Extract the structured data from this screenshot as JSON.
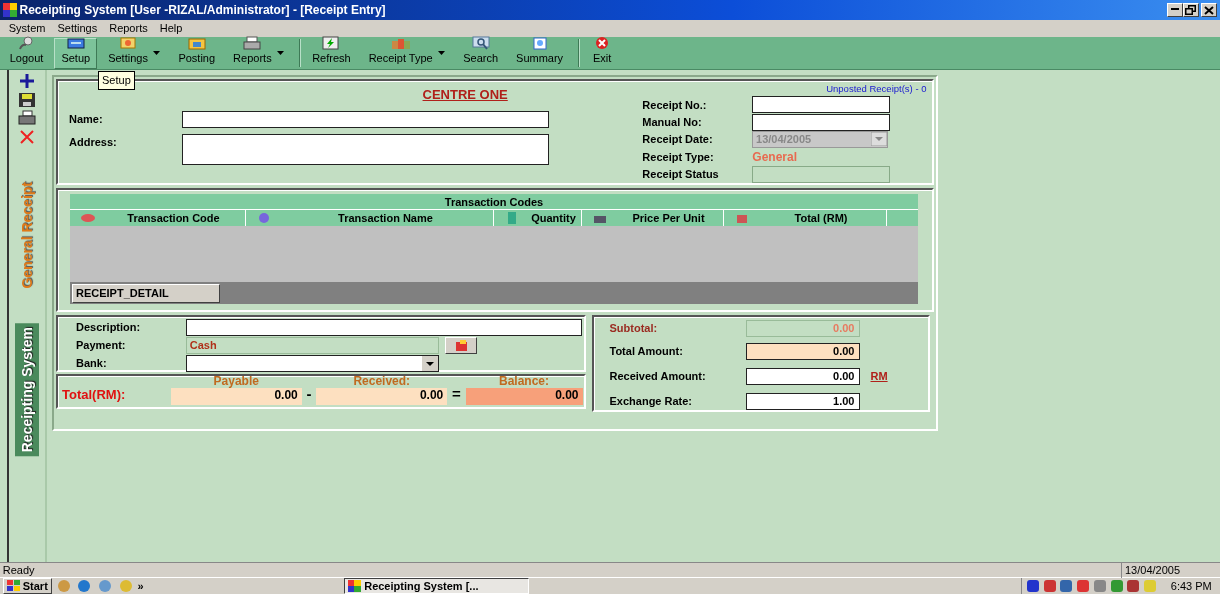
{
  "window": {
    "title": "Receipting System  [User -RIZAL/Administrator] - [Receipt Entry]"
  },
  "menu": [
    "System",
    "Settings",
    "Reports",
    "Help"
  ],
  "toolbar": [
    {
      "kind": "button",
      "label": "Logout",
      "dropdown": false,
      "selected": false
    },
    {
      "kind": "button",
      "label": "Setup",
      "dropdown": false,
      "selected": true
    },
    {
      "kind": "button",
      "label": "Settings",
      "dropdown": true,
      "selected": false
    },
    {
      "kind": "button",
      "label": "Posting",
      "dropdown": false,
      "selected": false
    },
    {
      "kind": "button",
      "label": "Reports",
      "dropdown": true,
      "selected": false
    },
    {
      "kind": "separator"
    },
    {
      "kind": "button",
      "label": "Refresh",
      "dropdown": false,
      "selected": false
    },
    {
      "kind": "button",
      "label": "Receipt Type",
      "dropdown": true,
      "selected": false
    },
    {
      "kind": "button",
      "label": "Search",
      "dropdown": false,
      "selected": false
    },
    {
      "kind": "button",
      "label": "Summary",
      "dropdown": false,
      "selected": false
    },
    {
      "kind": "separator"
    },
    {
      "kind": "button",
      "label": "Exit",
      "dropdown": false,
      "selected": false
    }
  ],
  "tooltip": "Setup",
  "side_tabs": [
    {
      "label": "General Receipt",
      "selected": true
    },
    {
      "label": "Receipting System",
      "selected": false
    }
  ],
  "header": {
    "centre": "CENTRE ONE",
    "unposted": "Unposted Receipt(s) - 0",
    "left_fields": [
      {
        "label": "Name:",
        "kind": "text"
      },
      {
        "label": "Address:",
        "kind": "textarea"
      }
    ],
    "right_fields": [
      {
        "label": "Receipt No.:",
        "kind": "text"
      },
      {
        "label": "Manual No:",
        "kind": "text"
      },
      {
        "label": "Receipt Date:",
        "kind": "date",
        "value": "13/04/2005",
        "disabled": true
      },
      {
        "label": "Receipt Type:",
        "kind": "static",
        "value": "General"
      },
      {
        "label": "Receipt Status",
        "kind": "readonly"
      }
    ]
  },
  "grid": {
    "title": "Transaction Codes",
    "columns": [
      "Transaction Code",
      "Transaction Name",
      "Quantity",
      "Price Per Unit",
      "Total (RM)"
    ],
    "tab": "RECEIPT_DETAIL"
  },
  "payment": [
    {
      "label": "Description:",
      "kind": "text"
    },
    {
      "label": "Payment:",
      "kind": "static",
      "value": "Cash"
    },
    {
      "label": "Bank:",
      "kind": "combo"
    }
  ],
  "totals": {
    "label": "Total(RM):",
    "items": [
      {
        "heading": "Payable",
        "value": "0.00",
        "highlight": false
      },
      {
        "heading": "Received:",
        "value": "0.00",
        "highlight": false
      },
      {
        "heading": "Balance:",
        "value": "0.00",
        "highlight": true
      }
    ],
    "operators": [
      "-",
      "="
    ]
  },
  "summary": [
    {
      "label": "Subtotal:",
      "value": "0.00",
      "disabled": true,
      "shaded": false
    },
    {
      "label": "Total Amount:",
      "value": "0.00",
      "disabled": false,
      "shaded": true
    },
    {
      "label": "Received Amount:",
      "value": "0.00",
      "disabled": false,
      "shaded": false,
      "unit": "RM"
    },
    {
      "label": "Exchange Rate:",
      "value": "1.00",
      "disabled": false,
      "shaded": false
    }
  ],
  "status_bar": {
    "message": "Ready",
    "date": "13/04/2005"
  },
  "taskbar": {
    "start": "Start",
    "more": "»",
    "task": "Receipting System  [...",
    "clock": "6:43 PM"
  }
}
